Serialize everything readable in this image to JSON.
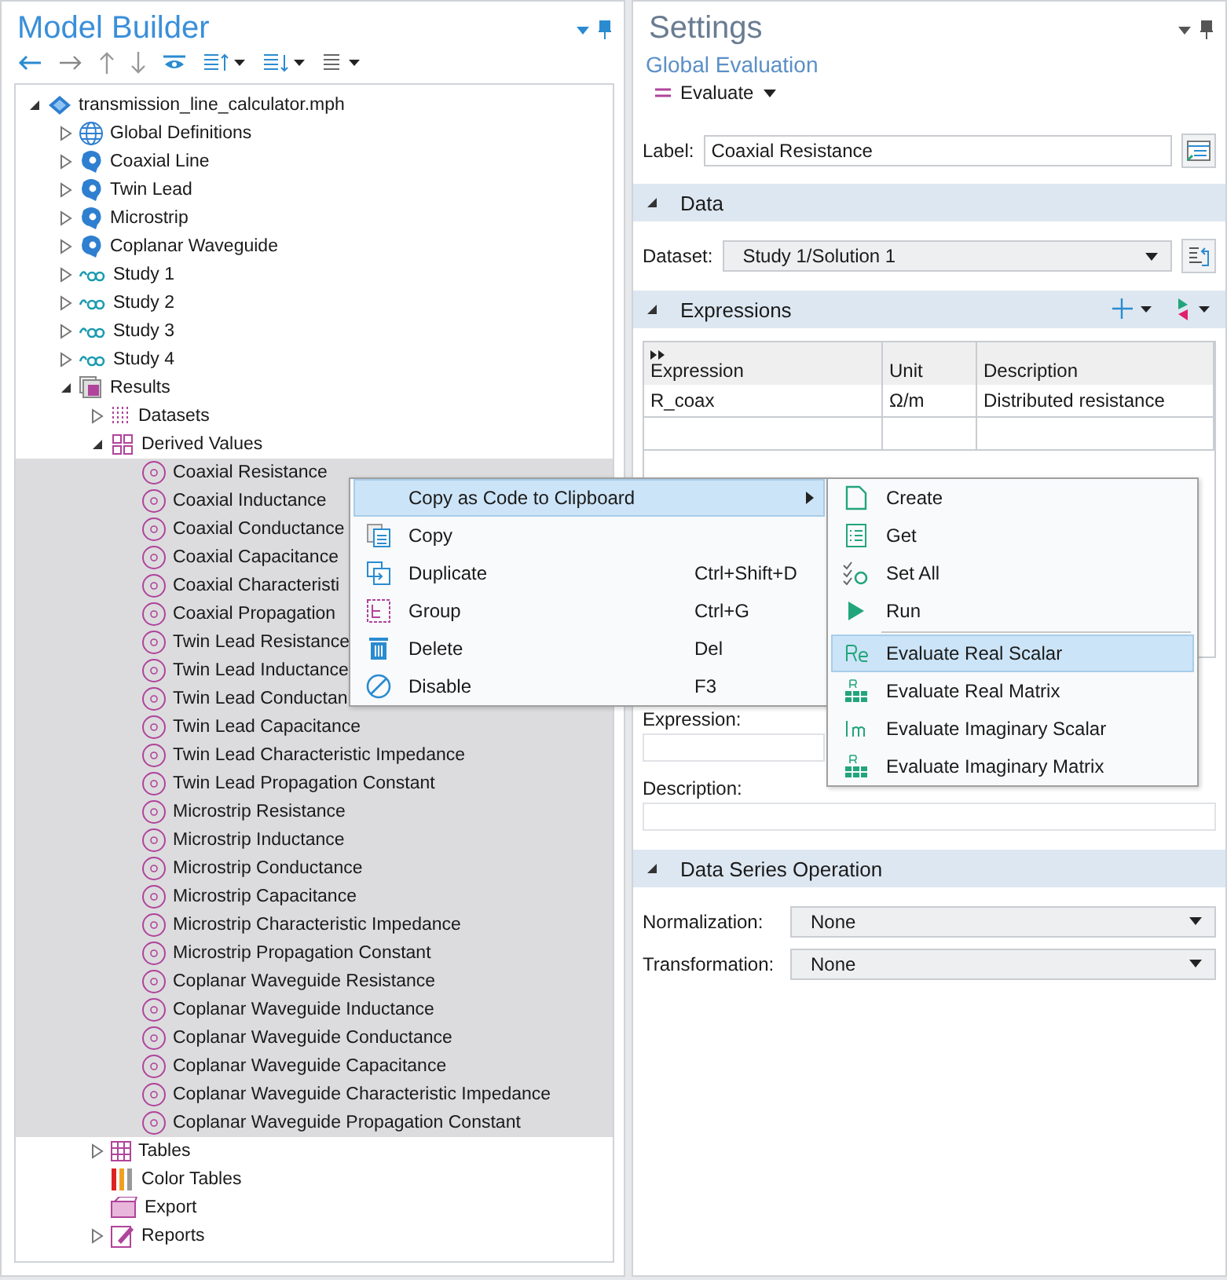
{
  "model_builder": {
    "title": "Model Builder",
    "tree": {
      "label": "transmission_line_calculator.mph",
      "kind": "file",
      "expanded": true,
      "selected": false,
      "children": [
        {
          "label": "Global Definitions",
          "kind": "globe",
          "expanded": false,
          "selected": false
        },
        {
          "label": "Coaxial Line",
          "kind": "component",
          "expanded": false,
          "selected": false
        },
        {
          "label": "Twin Lead",
          "kind": "component",
          "expanded": false,
          "selected": false
        },
        {
          "label": "Microstrip",
          "kind": "component",
          "expanded": false,
          "selected": false
        },
        {
          "label": "Coplanar Waveguide",
          "kind": "component",
          "expanded": false,
          "selected": false
        },
        {
          "label": "Study 1",
          "kind": "study",
          "expanded": false,
          "selected": false
        },
        {
          "label": "Study 2",
          "kind": "study",
          "expanded": false,
          "selected": false
        },
        {
          "label": "Study 3",
          "kind": "study",
          "expanded": false,
          "selected": false
        },
        {
          "label": "Study 4",
          "kind": "study",
          "expanded": false,
          "selected": false
        },
        {
          "label": "Results",
          "kind": "results",
          "expanded": true,
          "selected": false,
          "children": [
            {
              "label": "Datasets",
              "kind": "datasets",
              "expanded": false,
              "selected": false
            },
            {
              "label": "Derived Values",
              "kind": "derived",
              "expanded": true,
              "selected": false,
              "children": [
                {
                  "label": "Coaxial Resistance",
                  "kind": "value",
                  "selected": true
                },
                {
                  "label": "Coaxial Inductance",
                  "kind": "value",
                  "selected": true
                },
                {
                  "label": "Coaxial Conductance",
                  "kind": "value",
                  "selected": true
                },
                {
                  "label": "Coaxial Capacitance",
                  "kind": "value",
                  "selected": true
                },
                {
                  "label": "Coaxial Characteristi",
                  "kind": "value",
                  "selected": true
                },
                {
                  "label": "Coaxial Propagation",
                  "kind": "value",
                  "selected": true
                },
                {
                  "label": "Twin Lead Resistance",
                  "kind": "value",
                  "selected": true
                },
                {
                  "label": "Twin Lead Inductance",
                  "kind": "value",
                  "selected": true
                },
                {
                  "label": "Twin Lead Conductan",
                  "kind": "value",
                  "selected": true
                },
                {
                  "label": "Twin Lead Capacitance",
                  "kind": "value",
                  "selected": true
                },
                {
                  "label": "Twin Lead Characteristic Impedance",
                  "kind": "value",
                  "selected": true
                },
                {
                  "label": "Twin Lead Propagation Constant",
                  "kind": "value",
                  "selected": true
                },
                {
                  "label": "Microstrip Resistance",
                  "kind": "value",
                  "selected": true
                },
                {
                  "label": "Microstrip Inductance",
                  "kind": "value",
                  "selected": true
                },
                {
                  "label": "Microstrip Conductance",
                  "kind": "value",
                  "selected": true
                },
                {
                  "label": "Microstrip Capacitance",
                  "kind": "value",
                  "selected": true
                },
                {
                  "label": "Microstrip Characteristic Impedance",
                  "kind": "value",
                  "selected": true
                },
                {
                  "label": "Microstrip Propagation Constant",
                  "kind": "value",
                  "selected": true
                },
                {
                  "label": "Coplanar Waveguide Resistance",
                  "kind": "value",
                  "selected": true
                },
                {
                  "label": "Coplanar Waveguide Inductance",
                  "kind": "value",
                  "selected": true
                },
                {
                  "label": "Coplanar Waveguide Conductance",
                  "kind": "value",
                  "selected": true
                },
                {
                  "label": "Coplanar Waveguide Capacitance",
                  "kind": "value",
                  "selected": true
                },
                {
                  "label": "Coplanar Waveguide Characteristic Impedance",
                  "kind": "value",
                  "selected": true
                },
                {
                  "label": "Coplanar Waveguide Propagation Constant",
                  "kind": "value",
                  "selected": true
                }
              ]
            },
            {
              "label": "Tables",
              "kind": "tables",
              "expanded": false,
              "selected": false
            },
            {
              "label": "Color Tables",
              "kind": "colortables",
              "selected": false
            },
            {
              "label": "Export",
              "kind": "export",
              "selected": false
            },
            {
              "label": "Reports",
              "kind": "reports",
              "expanded": false,
              "selected": false
            }
          ]
        }
      ]
    }
  },
  "settings": {
    "title": "Settings",
    "subtitle": "Global Evaluation",
    "evaluate_button": "Evaluate",
    "label_field": {
      "label": "Label:",
      "value": "Coaxial Resistance"
    },
    "data_section": {
      "title": "Data",
      "expanded": true,
      "dataset_label": "Dataset:",
      "dataset_value": "Study 1/Solution 1"
    },
    "expressions_section": {
      "title": "Expressions",
      "expanded": true,
      "table": {
        "columns": [
          "Expression",
          "Unit",
          "Description"
        ],
        "rows": [
          [
            "R_coax",
            "Ω/m",
            "Distributed resistance"
          ]
        ]
      },
      "expression_label": "Expression:",
      "description_label": "Description:"
    },
    "data_series_section": {
      "title": "Data Series Operation",
      "expanded": true,
      "fields": [
        {
          "label": "Normalization:",
          "value": "None"
        },
        {
          "label": "Transformation:",
          "value": "None"
        }
      ]
    }
  },
  "context_menu": {
    "items": [
      {
        "label": "Copy as Code to Clipboard",
        "kind": "submenu",
        "selected": true
      },
      {
        "label": "Copy",
        "kind": "copy",
        "selected": false
      },
      {
        "label": "Duplicate",
        "kind": "duplicate",
        "shortcut": "Ctrl+Shift+D",
        "selected": false
      },
      {
        "label": "Group",
        "kind": "group",
        "shortcut": "Ctrl+G",
        "selected": false
      },
      {
        "label": "Delete",
        "kind": "delete",
        "shortcut": "Del",
        "selected": false
      },
      {
        "label": "Disable",
        "kind": "disable",
        "shortcut": "F3",
        "selected": false
      }
    ],
    "submenu": [
      {
        "label": "Create",
        "kind": "page",
        "selected": false
      },
      {
        "label": "Get",
        "kind": "list",
        "selected": false
      },
      {
        "label": "Set All",
        "kind": "setall",
        "selected": false
      },
      {
        "label": "Run",
        "kind": "run",
        "selected": false
      },
      {
        "kind": "separator"
      },
      {
        "label": "Evaluate Real Scalar",
        "kind": "re",
        "selected": true
      },
      {
        "label": "Evaluate Real Matrix",
        "kind": "rematrix",
        "selected": false
      },
      {
        "label": "Evaluate Imaginary Scalar",
        "kind": "im",
        "selected": false
      },
      {
        "label": "Evaluate Imaginary Matrix",
        "kind": "immatrix",
        "selected": false
      }
    ]
  }
}
